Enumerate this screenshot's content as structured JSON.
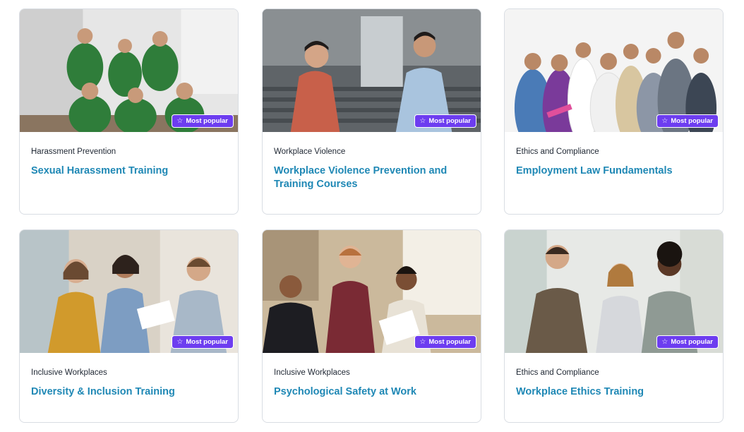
{
  "badge_label": "Most popular",
  "colors": {
    "accent": "#1f88b5",
    "badge": "#6d3df0"
  },
  "cards": [
    {
      "category": "Harassment Prevention",
      "title": "Sexual Harassment Training",
      "image": "team-in-green-shirts-photo",
      "badge": true
    },
    {
      "category": "Workplace Violence",
      "title": "Workplace Violence Prevention and Training Courses",
      "image": "two-men-arguing-photo",
      "badge": true
    },
    {
      "category": "Ethics and Compliance",
      "title": "Employment Law Fundamentals",
      "image": "diverse-professionals-group-photo",
      "badge": true
    },
    {
      "category": "Inclusive Workplaces",
      "title": "Diversity & Inclusion Training",
      "image": "colleagues-discussing-photo",
      "badge": true
    },
    {
      "category": "Inclusive Workplaces",
      "title": "Psychological Safety at Work",
      "image": "office-team-meeting-photo",
      "badge": true
    },
    {
      "category": "Ethics and Compliance",
      "title": "Workplace Ethics Training",
      "image": "business-people-talking-photo",
      "badge": true
    }
  ]
}
